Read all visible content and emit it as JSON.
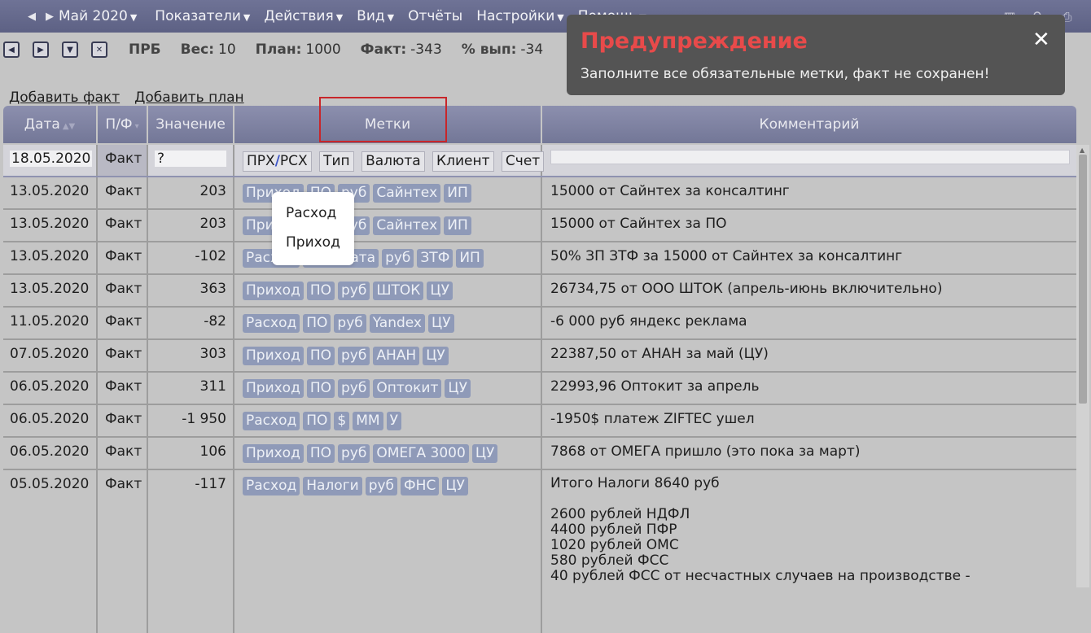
{
  "menubar": {
    "prev_icon": "triangle-left-icon",
    "next_icon": "triangle-right-icon",
    "month": "Май 2020",
    "menus": [
      "Показатели",
      "Действия",
      "Вид",
      "Отчёты",
      "Настройки",
      "Помощь"
    ],
    "right_icons": [
      "table-icon",
      "search-icon",
      "print-icon"
    ]
  },
  "infobar": {
    "buttons": [
      "first-icon",
      "next-icon",
      "down-icon",
      "close-icon"
    ],
    "account": "ПРБ",
    "weight_label": "Вес:",
    "weight": "10",
    "plan_label": "План:",
    "plan": "1000",
    "fact_label": "Факт:",
    "fact": "-343",
    "pct_label": "% вып:",
    "pct": "-34"
  },
  "links": {
    "add_fact": "Добавить факт",
    "add_plan": "Добавить план"
  },
  "table": {
    "headers": {
      "date": "Дата",
      "pf": "П/Ф",
      "value": "Значение",
      "tags": "Метки",
      "comment": "Комментарий"
    },
    "edit_row": {
      "date": "18.05.2020",
      "pf": "Факт",
      "value": "?",
      "tag_first_left": "ПРХ",
      "tag_first_sep": "/",
      "tag_first_right": "РСХ",
      "tags": [
        "Тип",
        "Валюта",
        "Клиент",
        "Счет"
      ],
      "comment": ""
    },
    "rows": [
      {
        "date": "13.05.2020",
        "pf": "Факт",
        "value": "203",
        "tags": [
          "Приход",
          "ПО",
          "руб",
          "Сайнтех",
          "ИП"
        ],
        "comment": "15000 от Сайнтех за консалтинг"
      },
      {
        "date": "13.05.2020",
        "pf": "Факт",
        "value": "203",
        "tags": [
          "Приход",
          "ПО",
          "руб",
          "Сайнтех",
          "ИП"
        ],
        "comment": "15000 от Сайнтех за ПО"
      },
      {
        "date": "13.05.2020",
        "pf": "Факт",
        "value": "-102",
        "tags": [
          "Расход",
          "Зарплата",
          "руб",
          "ЗТФ",
          "ИП"
        ],
        "comment": "50% ЗП ЗТФ за 15000 от Сайнтех за консалтинг"
      },
      {
        "date": "13.05.2020",
        "pf": "Факт",
        "value": "363",
        "tags": [
          "Приход",
          "ПО",
          "руб",
          "ШТОК",
          "ЦУ"
        ],
        "comment": "26734,75 от ООО ШТОК (апрель-июнь включительно)"
      },
      {
        "date": "11.05.2020",
        "pf": "Факт",
        "value": "-82",
        "tags": [
          "Расход",
          "ПО",
          "руб",
          "Yandex",
          "ЦУ"
        ],
        "comment": "-6 000 руб яндекс реклама"
      },
      {
        "date": "07.05.2020",
        "pf": "Факт",
        "value": "303",
        "tags": [
          "Приход",
          "ПО",
          "руб",
          "АНАН",
          "ЦУ"
        ],
        "comment": "22387,50 от АНАН за май (ЦУ)"
      },
      {
        "date": "06.05.2020",
        "pf": "Факт",
        "value": "311",
        "tags": [
          "Приход",
          "ПО",
          "руб",
          "Оптокит",
          "ЦУ"
        ],
        "comment": "22993,96 Оптокит за апрель"
      },
      {
        "date": "06.05.2020",
        "pf": "Факт",
        "value": "-1 950",
        "tags": [
          "Расход",
          "ПО",
          "$",
          "ММ",
          "У"
        ],
        "comment": "-1950$ платеж ZIFTEC ушел"
      },
      {
        "date": "06.05.2020",
        "pf": "Факт",
        "value": "106",
        "tags": [
          "Приход",
          "ПО",
          "руб",
          "ОМЕГА 3000",
          "ЦУ"
        ],
        "comment": "7868 от ОМЕГА пришло (это пока за март)"
      }
    ],
    "last_row": {
      "date": "05.05.2020",
      "pf": "Факт",
      "value": "-117",
      "tags": [
        "Расход",
        "Налоги",
        "руб",
        "ФНС",
        "ЦУ"
      ],
      "comment_lines": [
        "Итого Налоги 8640 руб",
        "",
        "2600 рублей НДФЛ",
        "4400 рублей ПФР",
        "1020 рублей ОМС",
        "580 рублей ФСС",
        "40 рублей ФСС от несчастных случаев на производстве -"
      ]
    }
  },
  "dropdown": {
    "options": [
      "Расход",
      "Приход"
    ]
  },
  "toast": {
    "title": "Предупреждение",
    "message": "Заполните все обязательные метки, факт не сохранен!",
    "close_icon": "close-icon"
  },
  "colors": {
    "header": "#7c80a0",
    "tag": "#8f9ab8",
    "warning_title": "#e84a4a",
    "highlight": "#c8262a"
  }
}
